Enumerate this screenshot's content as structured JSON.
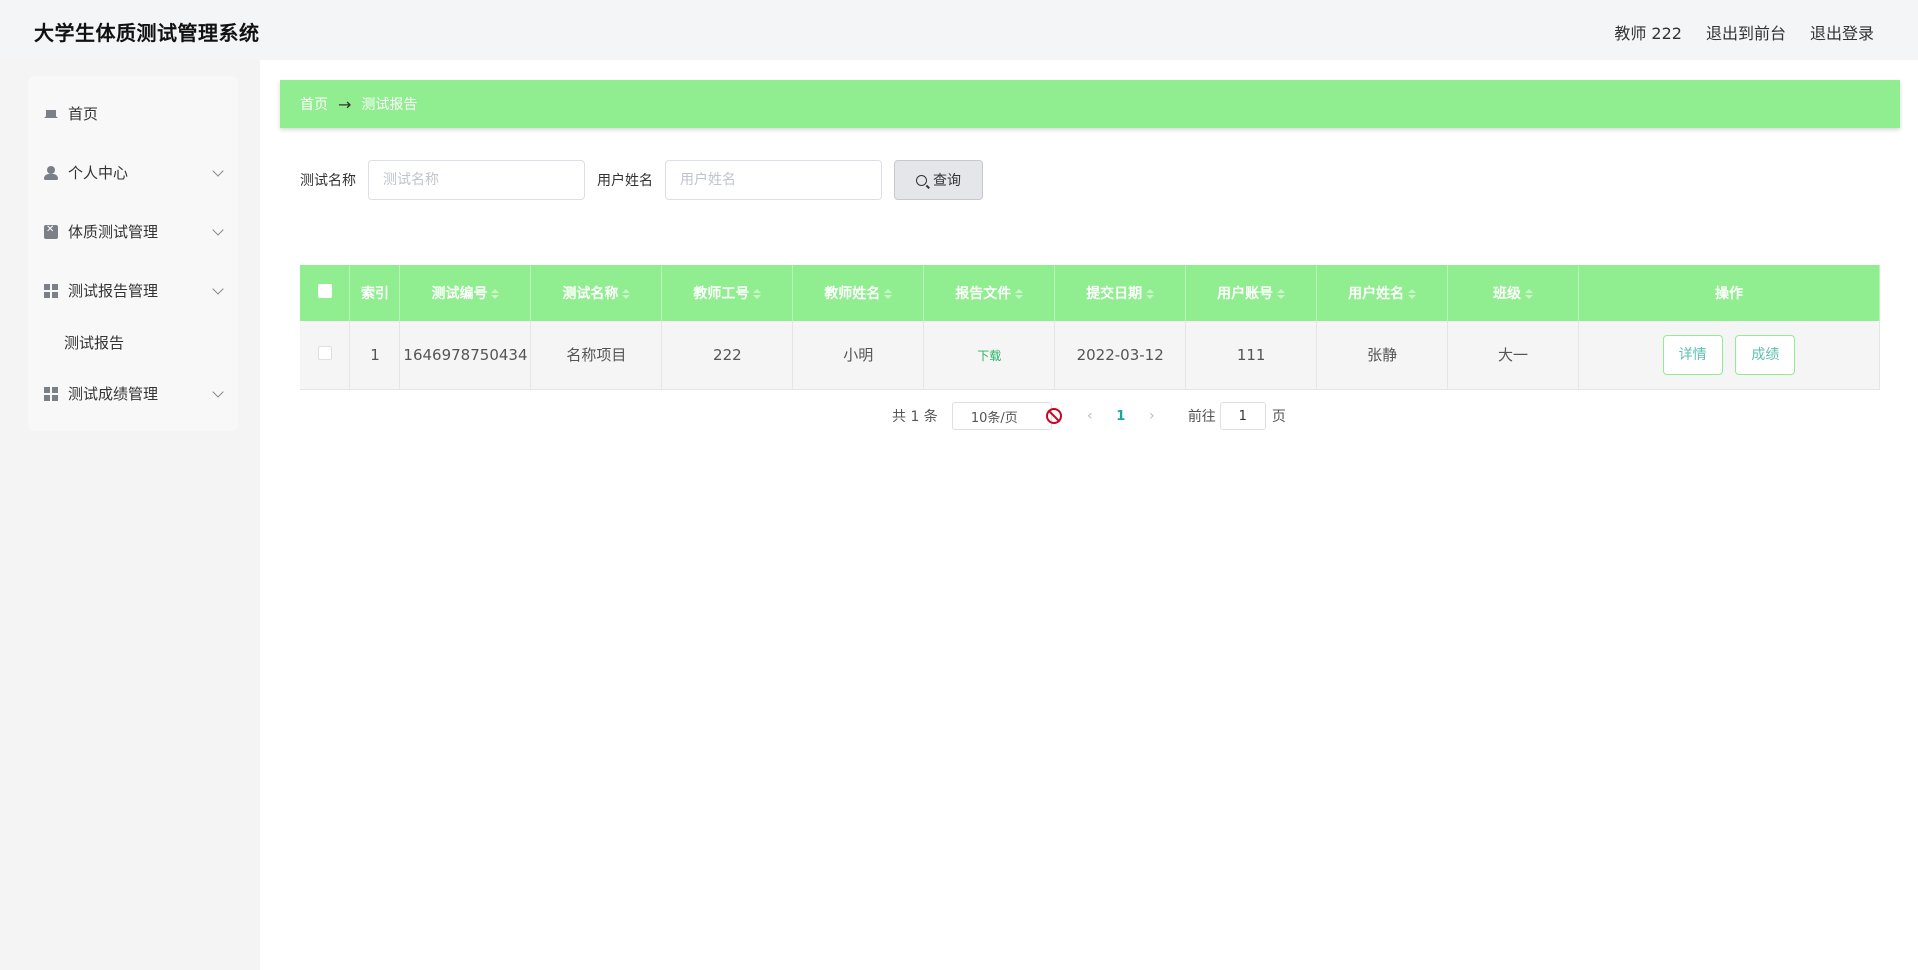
{
  "header": {
    "title": "大学生体质测试管理系统",
    "user": "教师 222",
    "back_front": "退出到前台",
    "logout": "退出登录"
  },
  "sidebar": {
    "items": [
      {
        "label": "首页",
        "icon": "home-icon"
      },
      {
        "label": "个人中心",
        "icon": "user-icon"
      },
      {
        "label": "体质测试管理",
        "icon": "clipboard-icon"
      },
      {
        "label": "测试报告管理",
        "icon": "grid-icon"
      },
      {
        "label": "测试报告",
        "icon": ""
      },
      {
        "label": "测试成绩管理",
        "icon": "grid-icon"
      }
    ]
  },
  "breadcrumb": {
    "home": "首页",
    "separator": "→",
    "current": "测试报告"
  },
  "search": {
    "name_label": "测试名称",
    "name_placeholder": "测试名称",
    "user_label": "用户姓名",
    "user_placeholder": "用户姓名",
    "query_button": "查询"
  },
  "table": {
    "columns": [
      "索引",
      "测试编号",
      "测试名称",
      "教师工号",
      "教师姓名",
      "报告文件",
      "提交日期",
      "用户账号",
      "用户姓名",
      "班级",
      "操作"
    ],
    "rows": [
      {
        "index": "1",
        "test_no": "1646978750434",
        "test_name": "名称项目",
        "teacher_id": "222",
        "teacher_name": "小明",
        "report_file": "下载",
        "submit_date": "2022-03-12",
        "user_account": "111",
        "user_name": "张静",
        "class": "大一",
        "detail_button": "详情",
        "score_button": "成绩"
      }
    ]
  },
  "pagination": {
    "total": "共 1 条",
    "page_size": "10条/页",
    "prev": "‹",
    "current_page": "1",
    "next": "›",
    "goto_label": "前往",
    "goto_value": "1",
    "goto_suffix": "页"
  },
  "colors": {
    "accent_green": "#90ee90",
    "link_green": "#28b463",
    "page_number": "#1aa79b"
  }
}
